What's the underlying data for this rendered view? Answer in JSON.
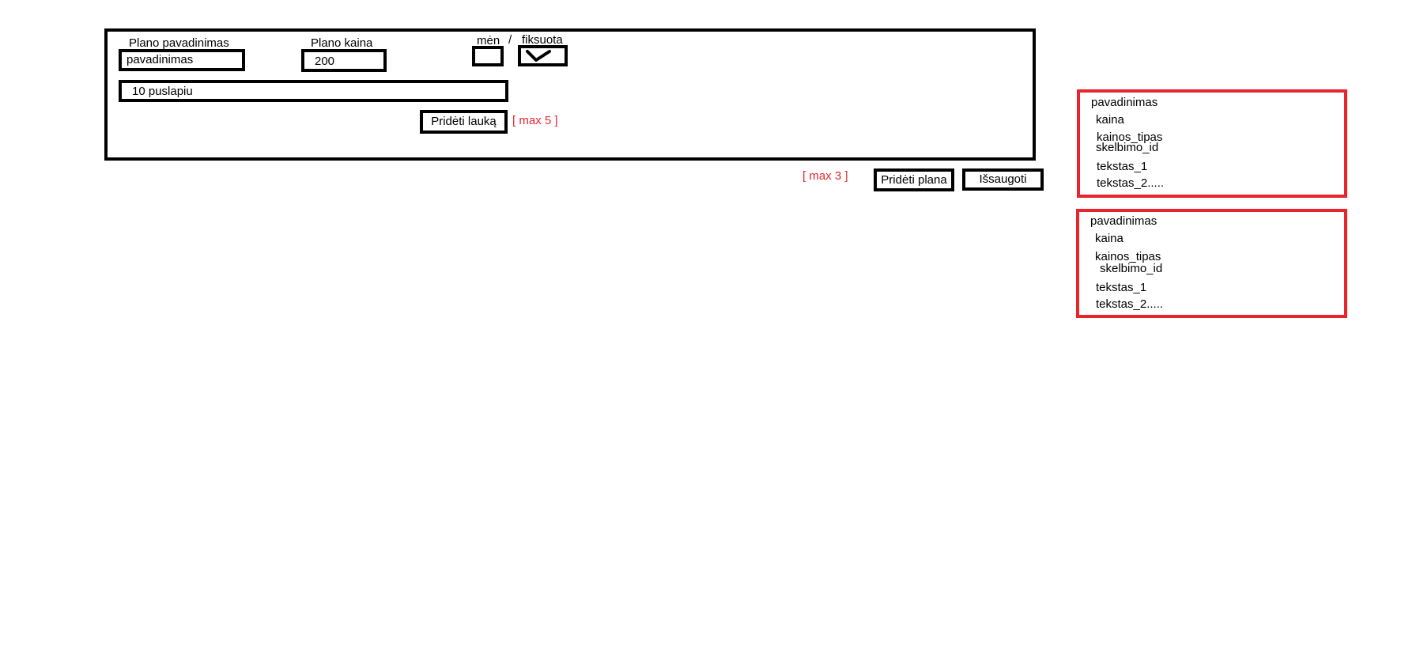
{
  "form": {
    "name_label": "Plano pavadinimas",
    "name_value": "pavadinimas",
    "price_label": "Plano kaina",
    "price_value": "200",
    "monthly_label": "mėn",
    "separator": "/",
    "fixed_label": "fiksuota",
    "fixed_checked": true,
    "field_value": "10 puslapiu",
    "add_field_label": "Pridėti lauką",
    "add_field_limit": "[ max 5 ]"
  },
  "footer": {
    "plan_limit": "[ max 3 ]",
    "add_plan_label": "Pridėti plana",
    "save_label": "Išsaugoti"
  },
  "previews": [
    {
      "lines": [
        "pavadinimas",
        "kaina",
        "kainos_tipas",
        "skelbimo_id",
        "tekstas_1",
        "tekstas_2....."
      ]
    },
    {
      "lines": [
        "pavadinimas",
        "kaina",
        "kainos_tipas",
        "skelbimo_id",
        "tekstas_1",
        "tekstas_2....."
      ]
    }
  ],
  "colors": {
    "border": "#000000",
    "accent_red": "#e8252d",
    "background": "#ffffff"
  }
}
